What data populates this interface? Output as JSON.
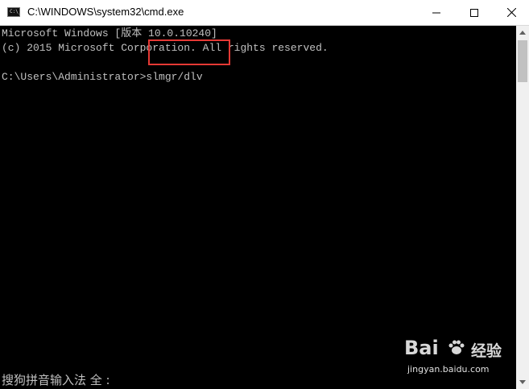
{
  "window": {
    "title": "C:\\WINDOWS\\system32\\cmd.exe",
    "icon_label": "C:\\_"
  },
  "console": {
    "lines": [
      "Microsoft Windows [版本 10.0.10240]",
      "(c) 2015 Microsoft Corporation. All rights reserved.",
      "",
      "C:\\Users\\Administrator>slmgr/dlv"
    ],
    "highlight_color": "#e53935",
    "text_color": "#c0c0c0",
    "background": "#000000"
  },
  "ime": {
    "status": "搜狗拼音输入法 全 :"
  },
  "watermark": {
    "brand_prefix": "Bai",
    "brand_suffix": "经验",
    "url": "jingyan.baidu.com"
  },
  "icons": [
    "cmd-app-icon",
    "minimize-icon",
    "maximize-icon",
    "close-icon",
    "scroll-up-icon",
    "scroll-down-icon",
    "paw-icon"
  ]
}
